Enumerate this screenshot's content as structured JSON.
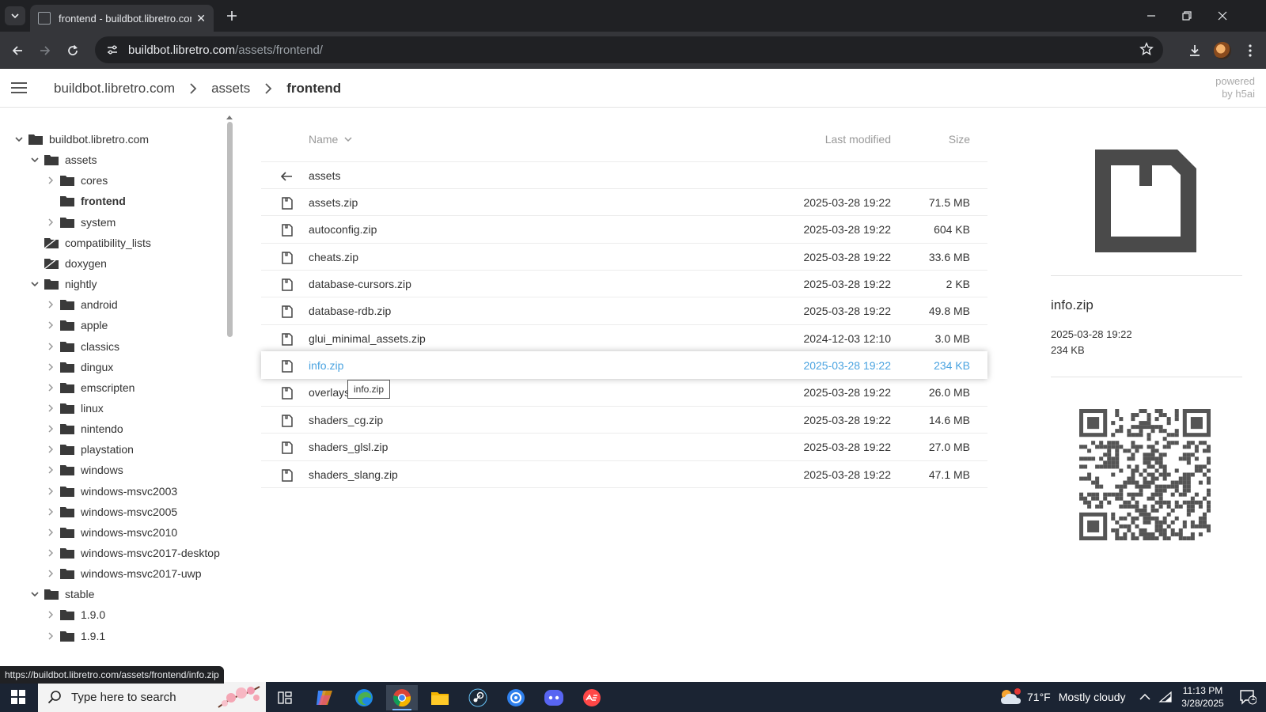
{
  "browser": {
    "tab_title": "frontend - buildbot.libretro.com",
    "url_host": "buildbot.libretro.com",
    "url_path": "/assets/frontend/",
    "status_url": "https://buildbot.libretro.com/assets/frontend/info.zip"
  },
  "header": {
    "crumbs": [
      "buildbot.libretro.com",
      "assets",
      "frontend"
    ],
    "powered_line1": "powered",
    "powered_line2": "by h5ai"
  },
  "tree": [
    {
      "label": "buildbot.libretro.com",
      "level": 0,
      "toggle": "open"
    },
    {
      "label": "assets",
      "level": 1,
      "toggle": "open"
    },
    {
      "label": "cores",
      "level": 2,
      "toggle": "closed"
    },
    {
      "label": "frontend",
      "level": 2,
      "toggle": "none",
      "current": true
    },
    {
      "label": "system",
      "level": 2,
      "toggle": "closed"
    },
    {
      "label": "compatibility_lists",
      "level": 1,
      "toggle": "none",
      "symlink": true
    },
    {
      "label": "doxygen",
      "level": 1,
      "toggle": "none",
      "symlink": true
    },
    {
      "label": "nightly",
      "level": 1,
      "toggle": "open"
    },
    {
      "label": "android",
      "level": 2,
      "toggle": "closed"
    },
    {
      "label": "apple",
      "level": 2,
      "toggle": "closed"
    },
    {
      "label": "classics",
      "level": 2,
      "toggle": "closed"
    },
    {
      "label": "dingux",
      "level": 2,
      "toggle": "closed"
    },
    {
      "label": "emscripten",
      "level": 2,
      "toggle": "closed"
    },
    {
      "label": "linux",
      "level": 2,
      "toggle": "closed"
    },
    {
      "label": "nintendo",
      "level": 2,
      "toggle": "closed"
    },
    {
      "label": "playstation",
      "level": 2,
      "toggle": "closed"
    },
    {
      "label": "windows",
      "level": 2,
      "toggle": "closed"
    },
    {
      "label": "windows-msvc2003",
      "level": 2,
      "toggle": "closed"
    },
    {
      "label": "windows-msvc2005",
      "level": 2,
      "toggle": "closed"
    },
    {
      "label": "windows-msvc2010",
      "level": 2,
      "toggle": "closed"
    },
    {
      "label": "windows-msvc2017-desktop",
      "level": 2,
      "toggle": "closed"
    },
    {
      "label": "windows-msvc2017-uwp",
      "level": 2,
      "toggle": "closed"
    },
    {
      "label": "stable",
      "level": 1,
      "toggle": "open"
    },
    {
      "label": "1.9.0",
      "level": 2,
      "toggle": "closed"
    },
    {
      "label": "1.9.1",
      "level": 2,
      "toggle": "closed"
    }
  ],
  "list": {
    "col_name": "Name",
    "col_modified": "Last modified",
    "col_size": "Size",
    "parent_label": "assets",
    "files": [
      {
        "name": "assets.zip",
        "date": "2025-03-28 19:22",
        "size": "71.5 MB"
      },
      {
        "name": "autoconfig.zip",
        "date": "2025-03-28 19:22",
        "size": "604 KB"
      },
      {
        "name": "cheats.zip",
        "date": "2025-03-28 19:22",
        "size": "33.6 MB"
      },
      {
        "name": "database-cursors.zip",
        "date": "2025-03-28 19:22",
        "size": "2 KB"
      },
      {
        "name": "database-rdb.zip",
        "date": "2025-03-28 19:22",
        "size": "49.8 MB"
      },
      {
        "name": "glui_minimal_assets.zip",
        "date": "2024-12-03 12:10",
        "size": "3.0 MB"
      },
      {
        "name": "info.zip",
        "date": "2025-03-28 19:22",
        "size": "234 KB",
        "selected": true
      },
      {
        "name": "overlays.zip",
        "date": "2025-03-28 19:22",
        "size": "26.0 MB"
      },
      {
        "name": "shaders_cg.zip",
        "date": "2025-03-28 19:22",
        "size": "14.6 MB"
      },
      {
        "name": "shaders_glsl.zip",
        "date": "2025-03-28 19:22",
        "size": "27.0 MB"
      },
      {
        "name": "shaders_slang.zip",
        "date": "2025-03-28 19:22",
        "size": "47.1 MB"
      }
    ],
    "tooltip": "info.zip"
  },
  "info": {
    "name": "info.zip",
    "date": "2025-03-28 19:22",
    "size": "234 KB"
  },
  "taskbar": {
    "search_placeholder": "Type here to search",
    "weather_temp": "71°F",
    "weather_text": "Mostly cloudy",
    "time": "11:13 PM",
    "date": "3/28/2025",
    "notification_count": "1"
  },
  "colors": {
    "accent_selected": "#4aa3e0",
    "chrome_dark": "#202124",
    "taskbar": "#1b2433"
  }
}
